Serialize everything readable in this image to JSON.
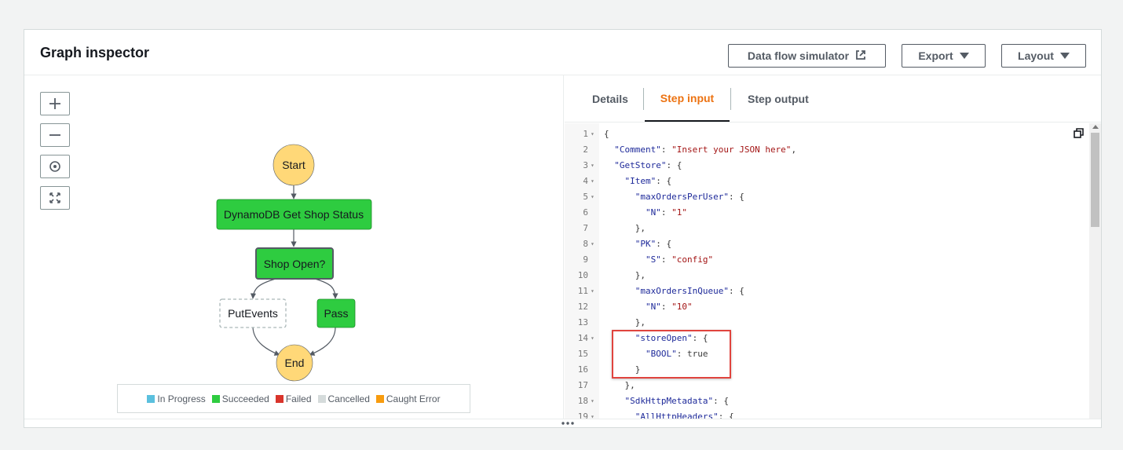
{
  "header": {
    "title": "Graph inspector",
    "data_flow_label": "Data flow simulator",
    "export_label": "Export",
    "layout_label": "Layout"
  },
  "zoom_controls": [
    "zoom-in-icon",
    "zoom-out-icon",
    "center-icon",
    "fit-icon"
  ],
  "graph": {
    "start": "Start",
    "get_status": "DynamoDB Get Shop Status",
    "choice": "Shop Open?",
    "put_events": "PutEvents",
    "pass": "Pass",
    "end": "End",
    "colors": {
      "succeeded": "#2ecc40",
      "terminal": "#ffd878",
      "edge": "#545b64"
    }
  },
  "legend": [
    {
      "label": "In Progress",
      "color": "#5bc0de"
    },
    {
      "label": "Succeeded",
      "color": "#2ecc40"
    },
    {
      "label": "Failed",
      "color": "#d9342b"
    },
    {
      "label": "Cancelled",
      "color": "#d5dbdb"
    },
    {
      "label": "Caught Error",
      "color": "#f89c0e"
    }
  ],
  "tabs": {
    "details": "Details",
    "step_input": "Step input",
    "step_output": "Step output",
    "active": "Step input",
    "active_color": "#ec7211"
  },
  "editor": {
    "lines": [
      {
        "n": "1",
        "fold": true,
        "text": "{"
      },
      {
        "n": "2",
        "fold": false,
        "text": "  \"Comment\": \"Insert your JSON here\","
      },
      {
        "n": "3",
        "fold": true,
        "text": "  \"GetStore\": {"
      },
      {
        "n": "4",
        "fold": true,
        "text": "    \"Item\": {"
      },
      {
        "n": "5",
        "fold": true,
        "text": "      \"maxOrdersPerUser\": {"
      },
      {
        "n": "6",
        "fold": false,
        "text": "        \"N\": \"1\""
      },
      {
        "n": "7",
        "fold": false,
        "text": "      },"
      },
      {
        "n": "8",
        "fold": true,
        "text": "      \"PK\": {"
      },
      {
        "n": "9",
        "fold": false,
        "text": "        \"S\": \"config\""
      },
      {
        "n": "10",
        "fold": false,
        "text": "      },"
      },
      {
        "n": "11",
        "fold": true,
        "text": "      \"maxOrdersInQueue\": {"
      },
      {
        "n": "12",
        "fold": false,
        "text": "        \"N\": \"10\""
      },
      {
        "n": "13",
        "fold": false,
        "text": "      },"
      },
      {
        "n": "14",
        "fold": true,
        "text": "      \"storeOpen\": {"
      },
      {
        "n": "15",
        "fold": false,
        "text": "        \"BOOL\": true"
      },
      {
        "n": "16",
        "fold": false,
        "text": "      }"
      },
      {
        "n": "17",
        "fold": false,
        "text": "    },"
      },
      {
        "n": "18",
        "fold": true,
        "text": "    \"SdkHttpMetadata\": {"
      },
      {
        "n": "19",
        "fold": true,
        "text": "      \"AllHttpHeaders\": {"
      }
    ]
  }
}
